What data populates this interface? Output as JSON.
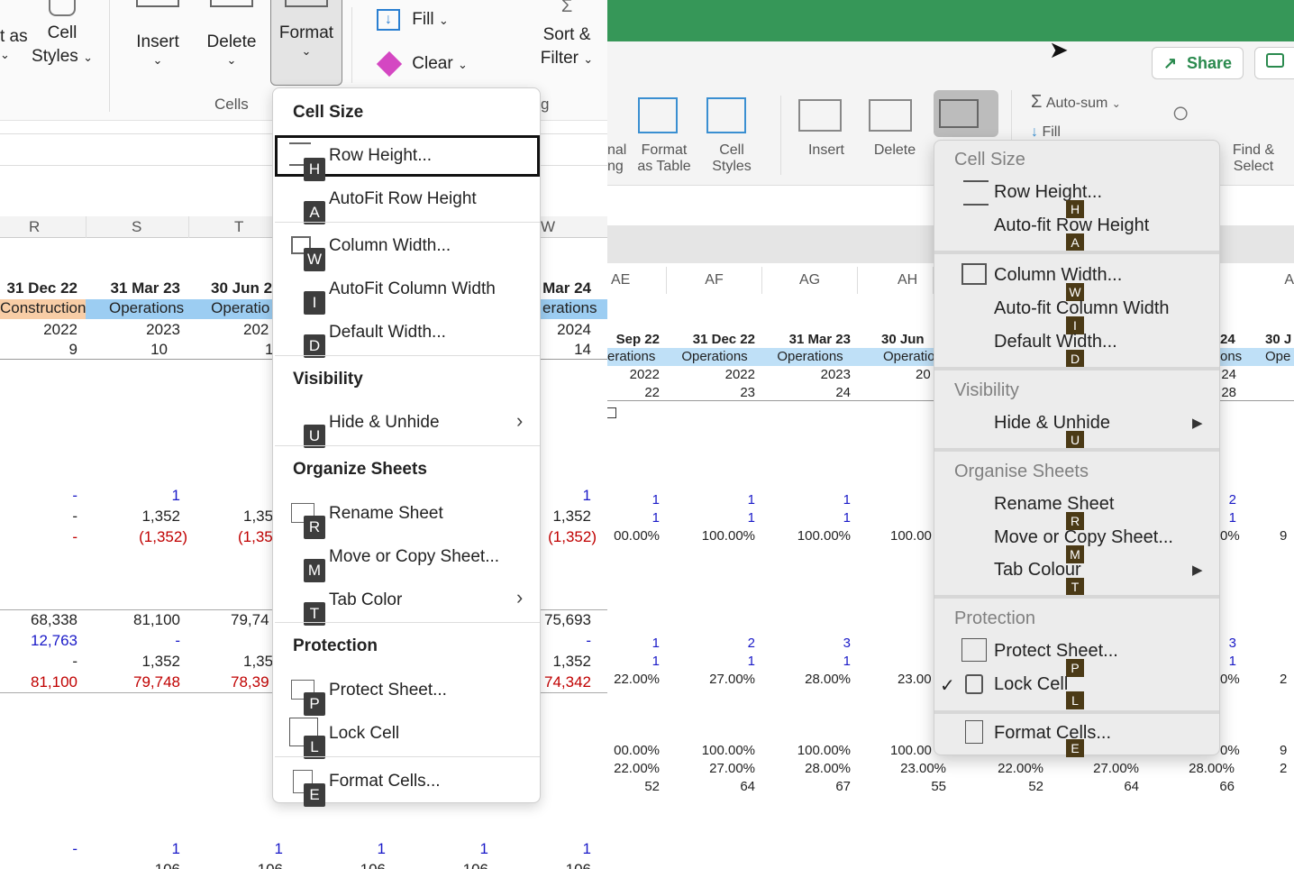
{
  "left": {
    "ribbon": {
      "cell_styles_partial": "t as",
      "cell_styles": "Cell",
      "cell_styles2": "Styles",
      "insert": "Insert",
      "delete": "Delete",
      "format": "Format",
      "fill": "Fill",
      "clear": "Clear",
      "sort_filter": "Sort &",
      "sort_filter2": "Filter",
      "group_cells": "Cells",
      "group_g": "g"
    },
    "columns": [
      "R",
      "S",
      "T",
      "W"
    ],
    "dates": [
      "31 Dec 22",
      "31 Mar 23",
      "30 Jun 2",
      "Mar 24"
    ],
    "phases": [
      "Construction",
      "Operations",
      "Operatio",
      "erations"
    ],
    "years": [
      "2022",
      "2023",
      "202",
      "2024"
    ],
    "periods": [
      "9",
      "10",
      "1",
      "14"
    ],
    "rows_a": [
      [
        "-",
        "1",
        "",
        "1"
      ],
      [
        "-",
        "1,352",
        "1,35",
        "1,352"
      ],
      [
        "-",
        "(1,352)",
        "(1,35",
        "(1,352)"
      ]
    ],
    "rows_b": [
      [
        "68,338",
        "81,100",
        "79,74",
        "75,693"
      ],
      [
        "12,763",
        "-",
        "",
        "-"
      ],
      [
        "-",
        "1,352",
        "1,35",
        "1,352"
      ],
      [
        "81,100",
        "79,748",
        "78,39",
        "74,342"
      ]
    ],
    "rows_c": [
      "-",
      "1",
      "1",
      "1",
      "1",
      "1"
    ],
    "rows_d": [
      "106",
      "106",
      "106",
      "106",
      "106"
    ],
    "menu": {
      "section_cell_size": "Cell Size",
      "row_height": "Row Height...",
      "autofit_row": "AutoFit Row Height",
      "col_width": "Column Width...",
      "autofit_col": "AutoFit Column Width",
      "default_width": "Default Width...",
      "section_visibility": "Visibility",
      "hide_unhide": "Hide & Unhide",
      "section_organize": "Organize Sheets",
      "rename": "Rename Sheet",
      "move_copy": "Move or Copy Sheet...",
      "tab_color": "Tab Color",
      "section_protection": "Protection",
      "protect": "Protect Sheet...",
      "lock_cell": "Lock Cell",
      "format_cells": "Format Cells...",
      "keys": {
        "H": "H",
        "A": "A",
        "W": "W",
        "I": "I",
        "D": "D",
        "U": "U",
        "R": "R",
        "M": "M",
        "T": "T",
        "P": "P",
        "L": "L",
        "E": "E"
      }
    }
  },
  "right": {
    "ribbon": {
      "share": "Share",
      "autosum": "Auto-sum",
      "fill": "Fill",
      "nal": "nal",
      "ng": "ng",
      "format_as_table": "Format",
      "format_as_table2": "as Table",
      "cell_styles": "Cell",
      "cell_styles2": "Styles",
      "insert": "Insert",
      "delete": "Delete",
      "find_select": "Find &",
      "find_select2": "Select"
    },
    "columns": [
      "AE",
      "AF",
      "AG",
      "AH",
      "A"
    ],
    "dates": [
      "Sep 22",
      "31 Dec 22",
      "31 Mar 23",
      "30 Jun",
      "24",
      "30 J"
    ],
    "phases": [
      "erations",
      "Operations",
      "Operations",
      "Operatio",
      "ons",
      "Ope"
    ],
    "years": [
      "2022",
      "2022",
      "2023",
      "20",
      "24"
    ],
    "periods": [
      "22",
      "23",
      "24",
      "28"
    ],
    "rows_a": [
      [
        "1",
        "1",
        "1",
        "2"
      ],
      [
        "1",
        "1",
        "1",
        "1"
      ],
      [
        "00.00%",
        "100.00%",
        "100.00%",
        "100.00",
        "0%",
        "9"
      ]
    ],
    "rows_b": [
      [
        "1",
        "2",
        "3",
        "3"
      ],
      [
        "1",
        "1",
        "1",
        "1"
      ],
      [
        "22.00%",
        "27.00%",
        "28.00%",
        "23.00",
        "0%",
        "2"
      ]
    ],
    "rows_c": [
      [
        "00.00%",
        "100.00%",
        "100.00%",
        "100.00",
        "0%",
        "9"
      ],
      [
        "22.00%",
        "27.00%",
        "28.00%",
        "23.00%",
        "22.00%",
        "27.00%",
        "28.00%",
        "2"
      ],
      [
        "52",
        "64",
        "67",
        "55",
        "52",
        "64",
        "66"
      ]
    ],
    "menu": {
      "section_cell_size": "Cell Size",
      "row_height": "Row Height...",
      "autofit_row": "Auto-fit Row Height",
      "col_width": "Column Width...",
      "autofit_col": "Auto-fit Column Width",
      "default_width": "Default Width...",
      "section_visibility": "Visibility",
      "hide_unhide": "Hide & Unhide",
      "section_organise": "Organise Sheets",
      "rename": "Rename Sheet",
      "move_copy": "Move or Copy Sheet...",
      "tab_colour": "Tab Colour",
      "section_protection": "Protection",
      "protect": "Protect Sheet...",
      "lock_cell": "Lock Cell",
      "lock_check": "✓",
      "format_cells": "Format Cells...",
      "keys": {
        "H": "H",
        "A": "A",
        "W": "W",
        "I": "I",
        "D": "D",
        "U": "U",
        "R": "R",
        "M": "M",
        "T": "T",
        "P": "P",
        "L": "L",
        "E": "E"
      }
    }
  },
  "colors": {
    "excel_green": "#369758",
    "construction": "#f8cda6",
    "operations": "#9ccdf2",
    "negative": "#c00000",
    "input_blue": "#1a1ac8"
  }
}
